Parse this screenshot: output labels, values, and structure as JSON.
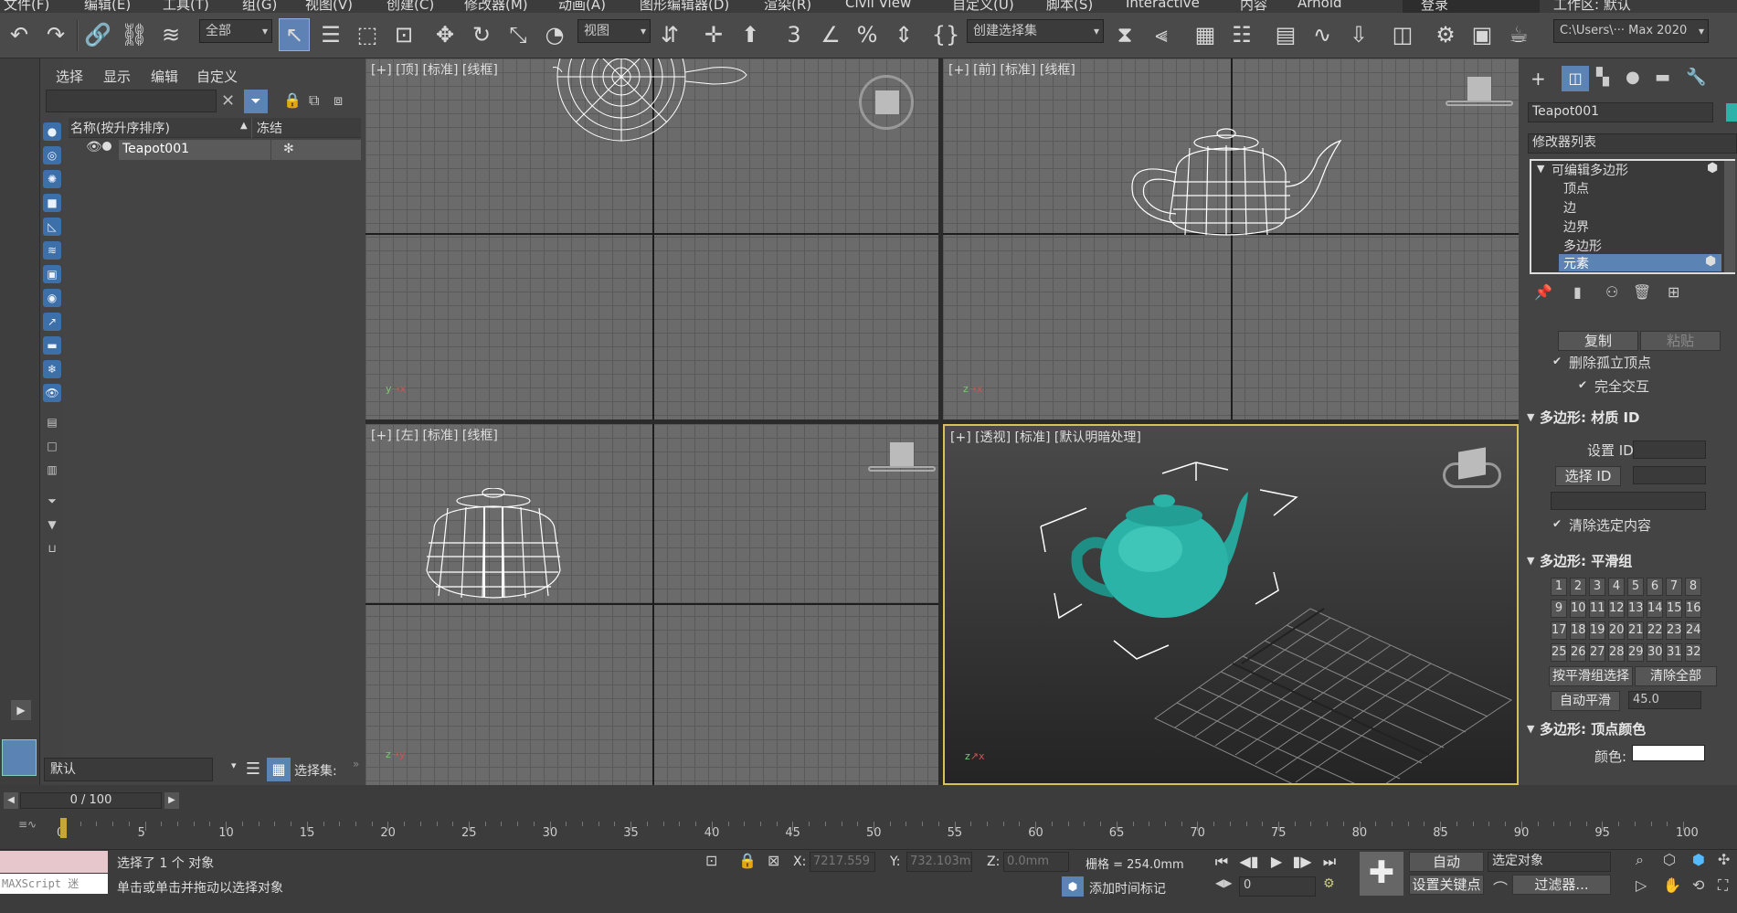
{
  "menubar": {
    "items": [
      "文件(F)",
      "编辑(E)",
      "工具(T)",
      "组(G)",
      "视图(V)",
      "创建(C)",
      "修改器(M)",
      "动画(A)",
      "图形编辑器(D)",
      "渲染(R)",
      "Civil View",
      "自定义(U)",
      "脚本(S)",
      "Interactive",
      "内容",
      "Arnold"
    ],
    "login": "登录",
    "workspace": "工作区: 默认"
  },
  "toolbar": {
    "filter": "全部",
    "view": "视图",
    "selection_set": "创建选择集",
    "path": "C:\\Users\\··· Max 2020"
  },
  "explorer": {
    "tabs": [
      "选择",
      "显示",
      "编辑",
      "自定义"
    ],
    "col_name": "名称(按升序排序)",
    "col_freeze": "冻结",
    "object": "Teapot001",
    "layer": "默认",
    "selset": "选择集:"
  },
  "viewports": {
    "top": "[+] [顶] [标准] [线框]",
    "front": "[+] [前] [标准] [线框]",
    "left": "[+] [左] [标准] [线框]",
    "persp": "[+] [透视] [标准] [默认明暗处理]",
    "teapot_color": "#2bb3a8"
  },
  "cmdpanel": {
    "object_name": "Teapot001",
    "modifier_list": "修改器列表",
    "stack": [
      "可编辑多边形",
      "顶点",
      "边",
      "边界",
      "多边形",
      "元素"
    ],
    "copy": "复制",
    "paste": "粘贴",
    "delete_iso": "删除孤立顶点",
    "full_interact": "完全交互",
    "mat_title": "多边形: 材质 ID",
    "set_id": "设置 ID:",
    "select_id": "选择 ID",
    "clear_sel": "清除选定内容",
    "smooth_title": "多边形: 平滑组",
    "smooth_groups": [
      "1",
      "2",
      "3",
      "4",
      "5",
      "6",
      "7",
      "8",
      "9",
      "10",
      "11",
      "12",
      "13",
      "14",
      "15",
      "16",
      "17",
      "18",
      "19",
      "20",
      "21",
      "22",
      "23",
      "24",
      "25",
      "26",
      "27",
      "28",
      "29",
      "30",
      "31",
      "32"
    ],
    "select_by_sg": "按平滑组选择",
    "clear_all": "清除全部",
    "auto_smooth": "自动平滑",
    "auto_smooth_val": "45.0",
    "vcolor_title": "多边形: 顶点颜色",
    "color_label": "颜色:"
  },
  "timeline": {
    "frame": "0 / 100",
    "ticks": [
      "0",
      "5",
      "10",
      "15",
      "20",
      "25",
      "30",
      "35",
      "40",
      "45",
      "50",
      "55",
      "60",
      "65",
      "70",
      "75",
      "80",
      "85",
      "90",
      "95",
      "100"
    ]
  },
  "status": {
    "maxscript": "MAXScript 迷",
    "selected": "选择了 1 个 对象",
    "hint": "单击或单击并拖动以选择对象",
    "x_label": "X:",
    "x_val": "7217.559",
    "y_label": "Y:",
    "y_val": "732.103m",
    "z_label": "Z:",
    "z_val": "0.0mm",
    "grid": "栅格 = 254.0mm",
    "add_tag": "添加时间标记",
    "auto": "自动",
    "sel_obj": "选定对象",
    "set_key": "设置关键点",
    "filters": "过滤器...",
    "frame_val": "0"
  }
}
